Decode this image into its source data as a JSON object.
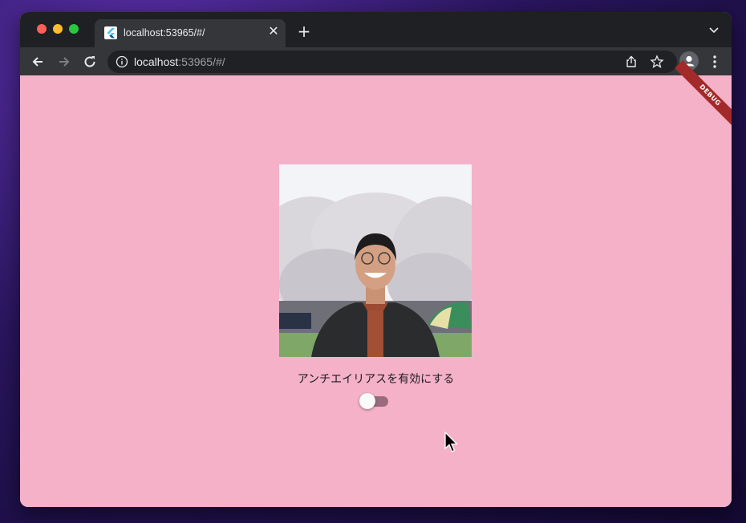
{
  "browser": {
    "tab": {
      "title": "localhost:53965/#/",
      "favicon": "flutter-icon"
    },
    "address": {
      "host": "localhost",
      "rest": ":53965/#/"
    },
    "icons": [
      "back-icon",
      "forward-icon",
      "reload-icon",
      "info-icon",
      "share-icon",
      "bookmark-star-icon",
      "profile-icon",
      "menu-icon",
      "close-icon",
      "plus-icon",
      "chevron-down-icon"
    ]
  },
  "app": {
    "background": "#f4b1c8",
    "debug_banner": "DEBUG",
    "toggle_label": "アンチエイリアスを有効にする",
    "antialias_enabled": false
  }
}
